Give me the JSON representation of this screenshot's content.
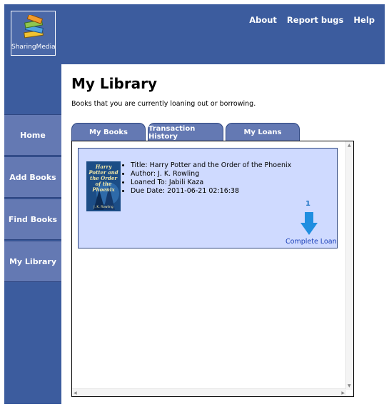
{
  "app": {
    "logo_text": "SharingMedia"
  },
  "topnav": {
    "items": [
      {
        "label": "About"
      },
      {
        "label": "Report bugs"
      },
      {
        "label": "Help"
      }
    ]
  },
  "sidebar": {
    "items": [
      {
        "label": "Home"
      },
      {
        "label": "Add Books"
      },
      {
        "label": "Find Books"
      },
      {
        "label": "My Library"
      }
    ]
  },
  "page": {
    "title": "My Library",
    "subtitle": "Books that you are currently loaning out or borrowing."
  },
  "tabs": [
    {
      "label": "My Books"
    },
    {
      "label": "Transaction History"
    },
    {
      "label": "My Loans"
    }
  ],
  "loan": {
    "cover_title": "Harry Potter and the Order of the Phoenix",
    "cover_author": "J. K. Rowling",
    "details": [
      "Title: Harry Potter and the Order of the Phoenix",
      "Author: J. K. Rowling",
      "Loaned To: Jabili Kaza",
      "Due Date: 2011-06-21 02:16:38"
    ],
    "counter": "1",
    "action_label": "Complete Loan"
  },
  "icons": {
    "logo": "books-logo-icon",
    "action": "down-arrow-icon"
  },
  "colors": {
    "header": "#3c5c9e",
    "nav_item": "#6479b3",
    "card": "#cfdaff",
    "action": "#1f8ee0"
  }
}
